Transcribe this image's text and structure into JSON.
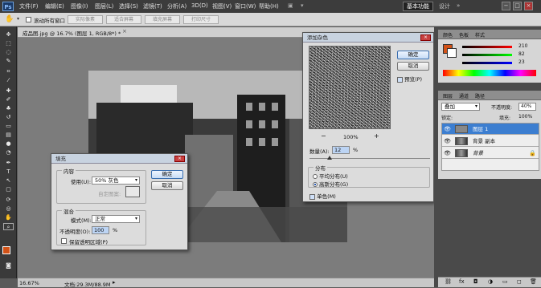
{
  "menubar": {
    "logo": "Ps",
    "items": [
      "文件(F)",
      "编辑(E)",
      "图像(I)",
      "图层(L)",
      "选择(S)",
      "滤镜(T)",
      "分析(A)",
      "3D(D)",
      "视图(V)",
      "窗口(W)",
      "帮助(H)"
    ],
    "workspace": "基本功能",
    "workspace_more": "设计",
    "window_controls": [
      "−",
      "□",
      "×"
    ]
  },
  "optbar": {
    "checkbox_label": "滚动所有窗口",
    "buttons": [
      "实际像素",
      "适合屏幕",
      "填充屏幕",
      "打印尺寸"
    ]
  },
  "doc": {
    "tab_title": "成品图.jpg @ 16.7% (图层 1, RGB/8*) *",
    "zoom": "16.67%",
    "status": "文档:29.3M/88.9M"
  },
  "fill_dialog": {
    "title": "填充",
    "contents_group": "内容",
    "use_label": "使用(U):",
    "use_value": "50% 灰色",
    "custom_pattern_label": "自定图案:",
    "blend_group": "混合",
    "mode_label": "模式(M):",
    "mode_value": "正常",
    "opacity_label": "不透明度(O):",
    "opacity_value": "100",
    "opacity_unit": "%",
    "preserve_label": "保留透明区域(P)",
    "ok": "确定",
    "cancel": "取消"
  },
  "noise_dialog": {
    "title": "添加杂色",
    "ok": "确定",
    "cancel": "取消",
    "preview_label": "预览(P)",
    "zoom_minus": "−",
    "zoom_value": "100%",
    "zoom_plus": "+",
    "amount_label": "数量(A):",
    "amount_value": "12",
    "amount_unit": "%",
    "distribution_group": "分布",
    "uniform_label": "平均分布(U)",
    "gaussian_label": "高斯分布(G)",
    "mono_label": "单色(M)"
  },
  "color_panel": {
    "tabs": [
      "颜色",
      "色板",
      "样式"
    ],
    "r_value": "210",
    "g_value": "82",
    "b_value": "23",
    "fg_color": "#d25217"
  },
  "layers_panel": {
    "tabs": [
      "图层",
      "通道",
      "路径"
    ],
    "blend_mode": "叠加",
    "opacity_label": "不透明度:",
    "opacity_value": "40%",
    "lock_label": "锁定:",
    "fill_label": "填充:",
    "fill_value": "100%",
    "layers": [
      "图层 1",
      "背景 副本",
      "背景"
    ]
  },
  "accent": "#1e6fd0"
}
